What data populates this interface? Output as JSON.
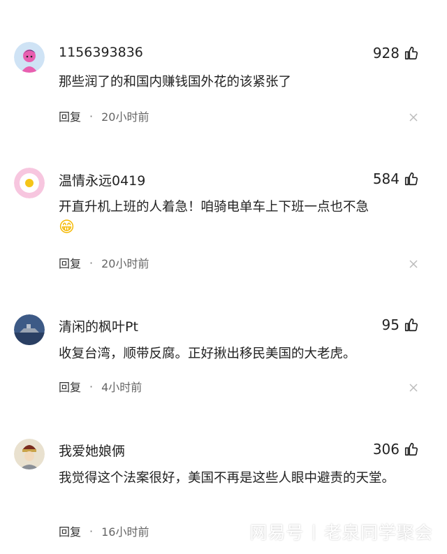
{
  "comments": [
    {
      "user": "1156393836",
      "likes": "928",
      "text": "那些润了的和国内赚钱国外花的该紧张了",
      "reply": "回复",
      "dot": "·",
      "time": "20小时前"
    },
    {
      "user": "温情永远0419",
      "likes": "584",
      "text": "开直升机上班的人着急！咱骑电单车上下班一点也不急",
      "emoji": "😁",
      "reply": "回复",
      "dot": "·",
      "time": "20小时前"
    },
    {
      "user": "清闲的枫叶Pt",
      "likes": "95",
      "text": "收复台湾，顺带反腐。正好揪出移民美国的大老虎。",
      "reply": "回复",
      "dot": "·",
      "time": "4小时前"
    },
    {
      "user": "我爱她娘俩",
      "likes": "306",
      "text": "我觉得这个法案很好，美国不再是这些人眼中避责的天堂。",
      "reply": "回复",
      "dot": "·",
      "time": "16小时前"
    }
  ],
  "watermark": {
    "brand": "网易号",
    "separator": "|",
    "author": "老泉同学聚会"
  }
}
